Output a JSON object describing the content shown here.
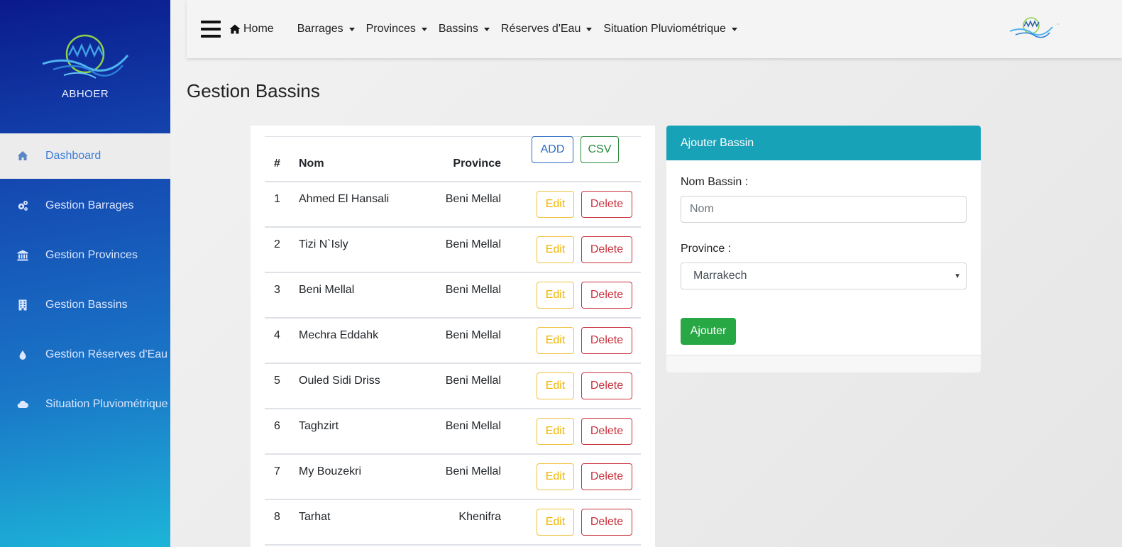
{
  "brand": {
    "name": "ABHOER"
  },
  "sidebar": {
    "items": [
      {
        "label": "Dashboard",
        "icon": "home-icon"
      },
      {
        "label": "Gestion Barrages",
        "icon": "gears-icon"
      },
      {
        "label": "Gestion Provinces",
        "icon": "bank-icon"
      },
      {
        "label": "Gestion Bassins",
        "icon": "building-icon"
      },
      {
        "label": "Gestion Réserves d'Eau",
        "icon": "water-drop-icon"
      },
      {
        "label": "Situation Pluviométrique",
        "icon": "cloud-icon"
      }
    ]
  },
  "topnav": {
    "home": "Home",
    "items": [
      "Barrages",
      "Provinces",
      "Bassins",
      "Réserves d'Eau",
      "Situation Pluviométrique"
    ]
  },
  "page": {
    "title": "Gestion Bassins"
  },
  "table": {
    "headers": {
      "num": "#",
      "nom": "Nom",
      "province": "Province"
    },
    "add_label": "ADD",
    "csv_label": "CSV",
    "edit_label": "Edit",
    "delete_label": "Delete",
    "rows": [
      {
        "num": "1",
        "nom": "Ahmed El Hansali",
        "province": "Beni Mellal"
      },
      {
        "num": "2",
        "nom": "Tizi N`Isly",
        "province": "Beni Mellal"
      },
      {
        "num": "3",
        "nom": "Beni Mellal",
        "province": "Beni Mellal"
      },
      {
        "num": "4",
        "nom": "Mechra Eddahk",
        "province": "Beni Mellal"
      },
      {
        "num": "5",
        "nom": "Ouled Sidi Driss",
        "province": "Beni Mellal"
      },
      {
        "num": "6",
        "nom": "Taghzirt",
        "province": "Beni Mellal"
      },
      {
        "num": "7",
        "nom": "My Bouzekri",
        "province": "Beni Mellal"
      },
      {
        "num": "8",
        "nom": "Tarhat",
        "province": "Khenifra"
      }
    ]
  },
  "form": {
    "title": "Ajouter Bassin",
    "nom_label": "Nom Bassin :",
    "nom_placeholder": "Nom",
    "province_label": "Province :",
    "province_value": "Marrakech",
    "submit_label": "Ajouter"
  },
  "colors": {
    "form_header": "#17a2b8",
    "submit": "#28a745",
    "edit": "#f0b400",
    "delete": "#c8323e",
    "add": "#2b6cc4",
    "csv": "#2a8a3c"
  }
}
